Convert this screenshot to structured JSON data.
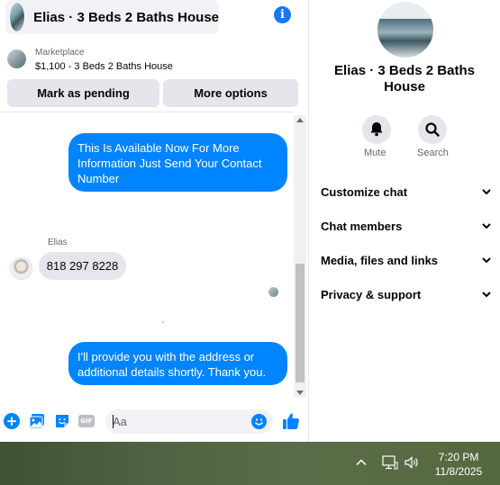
{
  "chat": {
    "title": "Elias · 3 Beds 2 Baths House",
    "listing": {
      "kicker": "Marketplace",
      "title": "$1,100 - 3 Beds 2 Baths House"
    },
    "actions": {
      "mark_pending": "Mark as pending",
      "more_options": "More options"
    },
    "messages": [
      {
        "direction": "outgoing",
        "text": "This Is Available Now For More Information Just Send Your Contact Number"
      },
      {
        "direction": "incoming",
        "sender": "Elias",
        "text": "818 297 8228"
      },
      {
        "direction": "outgoing",
        "text": "I'll provide you with the address or additional details shortly. Thank you."
      }
    ],
    "composer": {
      "placeholder": "Aa",
      "gif_label": "GIF"
    }
  },
  "info_panel": {
    "name": "Elias · 3 Beds 2 Baths House",
    "mute_label": "Mute",
    "search_label": "Search",
    "sections": [
      "Customize chat",
      "Chat members",
      "Media, files and links",
      "Privacy & support"
    ]
  },
  "taskbar": {
    "time": "7:20 PM",
    "date": "11/8/2025"
  },
  "colors": {
    "accent": "#0084ff",
    "messenger_blue": "#1877f2",
    "incoming_bubble": "#e4e6eb",
    "button_bg": "#e4e6eb"
  }
}
